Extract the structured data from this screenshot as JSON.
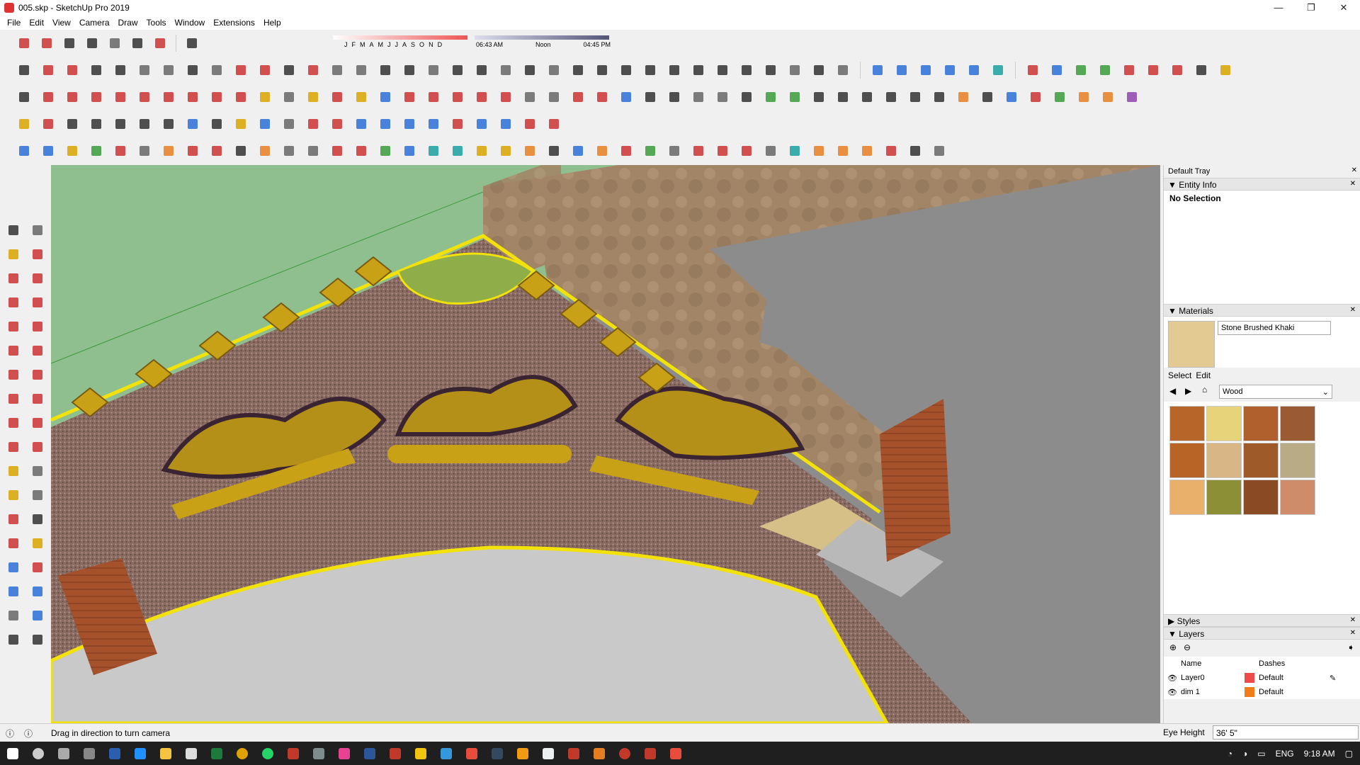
{
  "window": {
    "title": "005.skp - SketchUp Pro 2019",
    "controls": {
      "minimize": "—",
      "maximize": "❐",
      "close": "✕"
    }
  },
  "menu": [
    "File",
    "Edit",
    "View",
    "Camera",
    "Draw",
    "Tools",
    "Window",
    "Extensions",
    "Help"
  ],
  "shadow": {
    "months": [
      "J",
      "F",
      "M",
      "A",
      "M",
      "J",
      "J",
      "A",
      "S",
      "O",
      "N",
      "D"
    ],
    "time_start": "06:43 AM",
    "time_mid": "Noon",
    "time_end": "04:45 PM"
  },
  "tray": {
    "title": "Default Tray",
    "entity_info": {
      "title": "Entity Info",
      "selection": "No Selection"
    },
    "materials": {
      "title": "Materials",
      "current_name": "Stone Brushed Khaki",
      "tab_select": "Select",
      "tab_edit": "Edit",
      "library": "Wood",
      "swatches": [
        "#b8652a",
        "#e7d37a",
        "#b0602c",
        "#9a5a34",
        "#b86427",
        "#d8b686",
        "#9f5a2a",
        "#b8ab86",
        "#e8b06a",
        "#8d8f36",
        "#8a4a24",
        "#cf8c6a"
      ]
    },
    "styles": {
      "title": "Styles"
    },
    "layers": {
      "title": "Layers",
      "col_name": "Name",
      "col_dashes": "Dashes",
      "rows": [
        {
          "name": "Layer0",
          "color": "#ef4b4b",
          "dashes": "Default"
        },
        {
          "name": "dim 1",
          "color": "#f07d1a",
          "dashes": "Default"
        }
      ]
    }
  },
  "status": {
    "hint": "Drag in direction to turn camera",
    "eye_label": "Eye Height",
    "eye_value": "36' 5\""
  },
  "taskbar": {
    "lang": "ENG",
    "time": "9:18 AM"
  }
}
